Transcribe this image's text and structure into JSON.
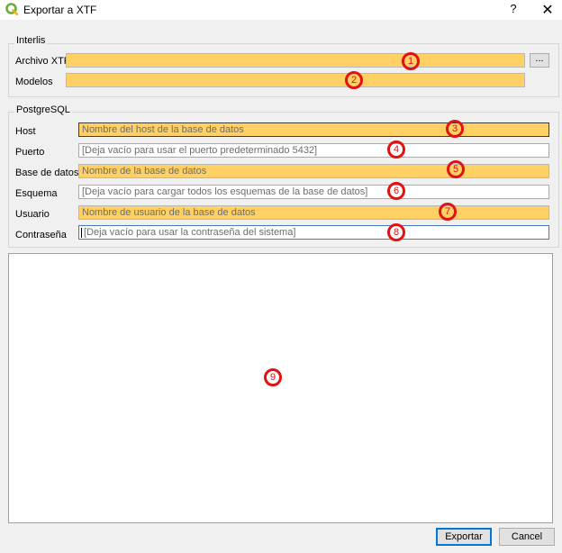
{
  "window": {
    "title": "Exportar a XTF",
    "help": "?",
    "close": "✕"
  },
  "interlis": {
    "group_title": "Interlis",
    "archivo_label": "Archivo XTF",
    "archivo_value": "",
    "browse": "...",
    "modelos_label": "Modelos",
    "modelos_value": ""
  },
  "postgresql": {
    "group_title": "PostgreSQL",
    "host_label": "Host",
    "host_placeholder": "Nombre del host de la base de datos",
    "puerto_label": "Puerto",
    "puerto_placeholder": "[Deja vacío para usar el puerto predeterminado 5432]",
    "base_label": "Base de datos",
    "base_placeholder": "Nombre de la base de datos",
    "esquema_label": "Esquema",
    "esquema_placeholder": "[Deja vacío para cargar todos los esquemas de la base de datos]",
    "usuario_label": "Usuario",
    "usuario_placeholder": "Nombre de usuario de la base de datos",
    "contrasena_label": "Contraseña",
    "contrasena_placeholder": "[Deja vacío para usar la contraseña del sistema]"
  },
  "markers": [
    "1",
    "2",
    "3",
    "4",
    "5",
    "6",
    "7",
    "8",
    "9"
  ],
  "buttons": {
    "export": "Exportar",
    "cancel": "Cancel"
  },
  "colors": {
    "required_field": "#ffd064",
    "marker": "#e21212",
    "primary_border": "#0078d7",
    "app_icon": "#6bae3f"
  },
  "icons": {
    "app": "qgis-icon"
  }
}
